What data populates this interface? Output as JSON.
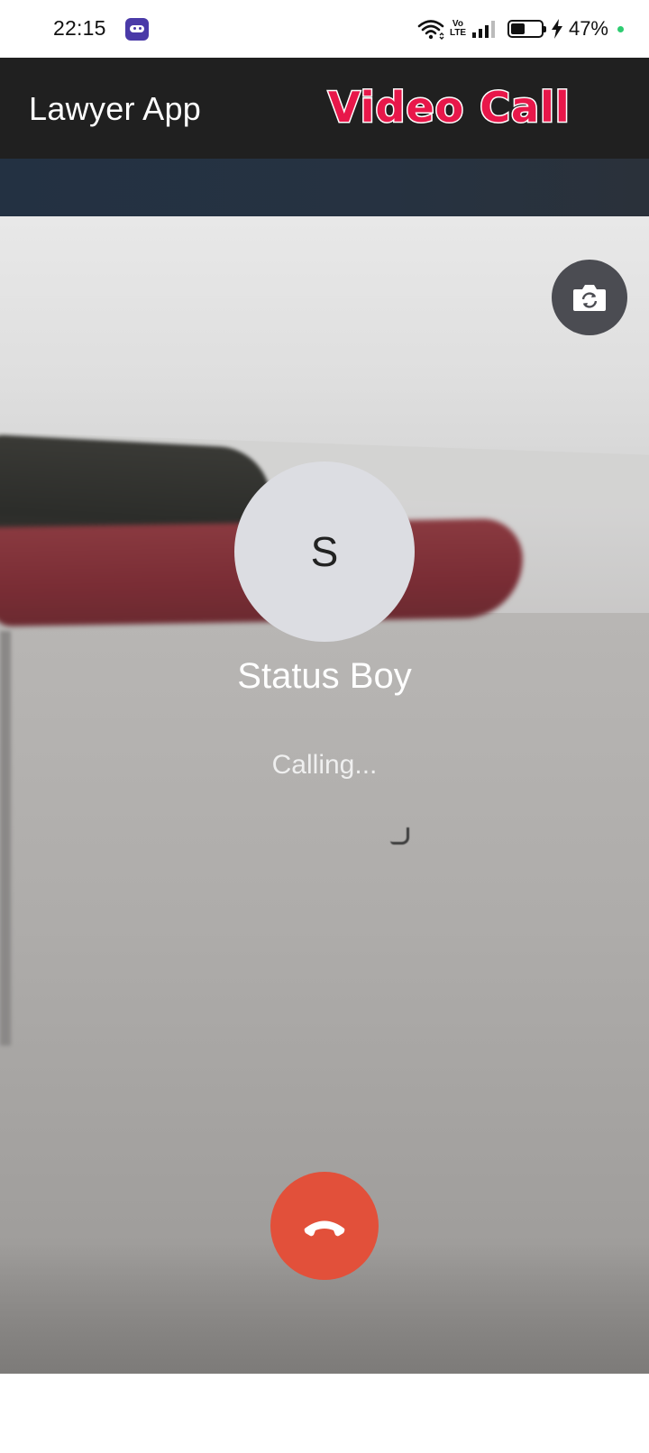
{
  "status_bar": {
    "time": "22:15",
    "network_label": "Vo\nLTE",
    "battery_percent_text": "47%",
    "battery_level": 0.47,
    "notification_app_icon": "game-controller-icon",
    "charging_dot_color": "#2ecc71",
    "icons": [
      "wifi-icon",
      "volte-icon",
      "signal-icon",
      "battery-icon",
      "charging-bolt-icon"
    ]
  },
  "app_bar": {
    "title": "Lawyer App",
    "overlay_label": "Video Call",
    "background_color": "#202020",
    "overlay_label_color": "#e8174a"
  },
  "call": {
    "avatar_initial": "S",
    "callee_name": "Status Boy",
    "status": "Calling...",
    "switch_camera_icon": "switch-camera-icon",
    "end_call_icon": "end-call-icon",
    "end_call_color": "#e2503a",
    "switch_camera_bg_color": "#4b4c52"
  }
}
